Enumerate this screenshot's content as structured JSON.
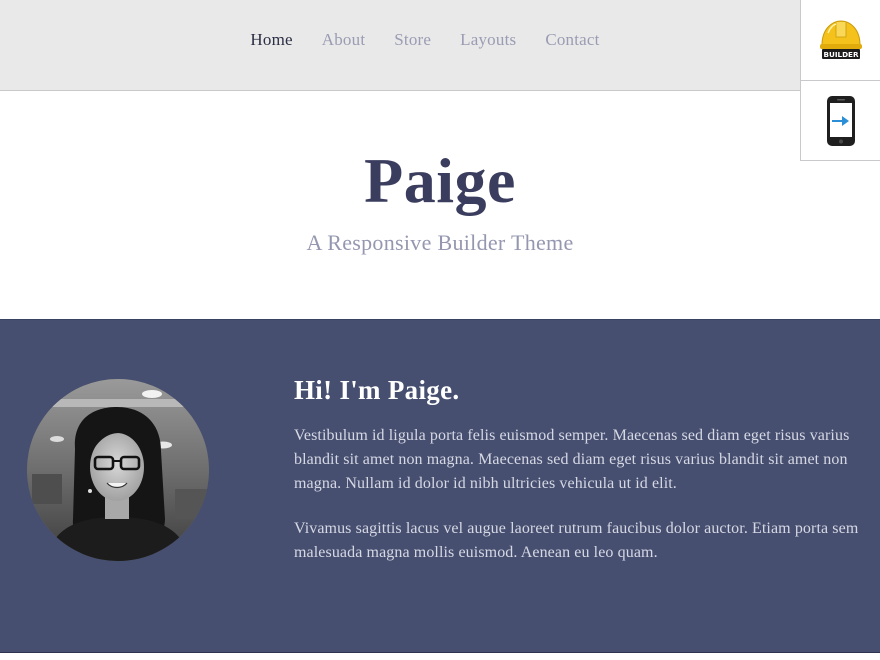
{
  "nav": {
    "items": [
      {
        "label": "Home",
        "active": true
      },
      {
        "label": "About",
        "active": false
      },
      {
        "label": "Store",
        "active": false
      },
      {
        "label": "Layouts",
        "active": false
      },
      {
        "label": "Contact",
        "active": false
      }
    ]
  },
  "side_panel": {
    "builder_label": "BUILDER",
    "builder_icon": "hardhat-icon",
    "mobile_icon": "mobile-preview-icon"
  },
  "header": {
    "title": "Paige",
    "tagline": "A Responsive Builder Theme"
  },
  "intro": {
    "heading": "Hi! I'm Paige.",
    "paragraphs": [
      "Vestibulum id ligula porta felis euismod semper. Maecenas sed diam eget risus varius blandit sit amet non magna. Maecenas sed diam eget risus varius blandit sit amet non magna. Nullam id dolor id nibh ultricies vehicula ut id elit.",
      "Vivamus sagittis lacus vel augue laoreet rutrum faucibus dolor auctor. Etiam porta sem malesuada magna mollis euismod. Aenean eu leo quam."
    ]
  },
  "colors": {
    "nav_bg": "#e9e9e9",
    "title": "#3b3d5e",
    "intro_bg": "#464f70",
    "builder_yellow": "#f5c21b"
  }
}
